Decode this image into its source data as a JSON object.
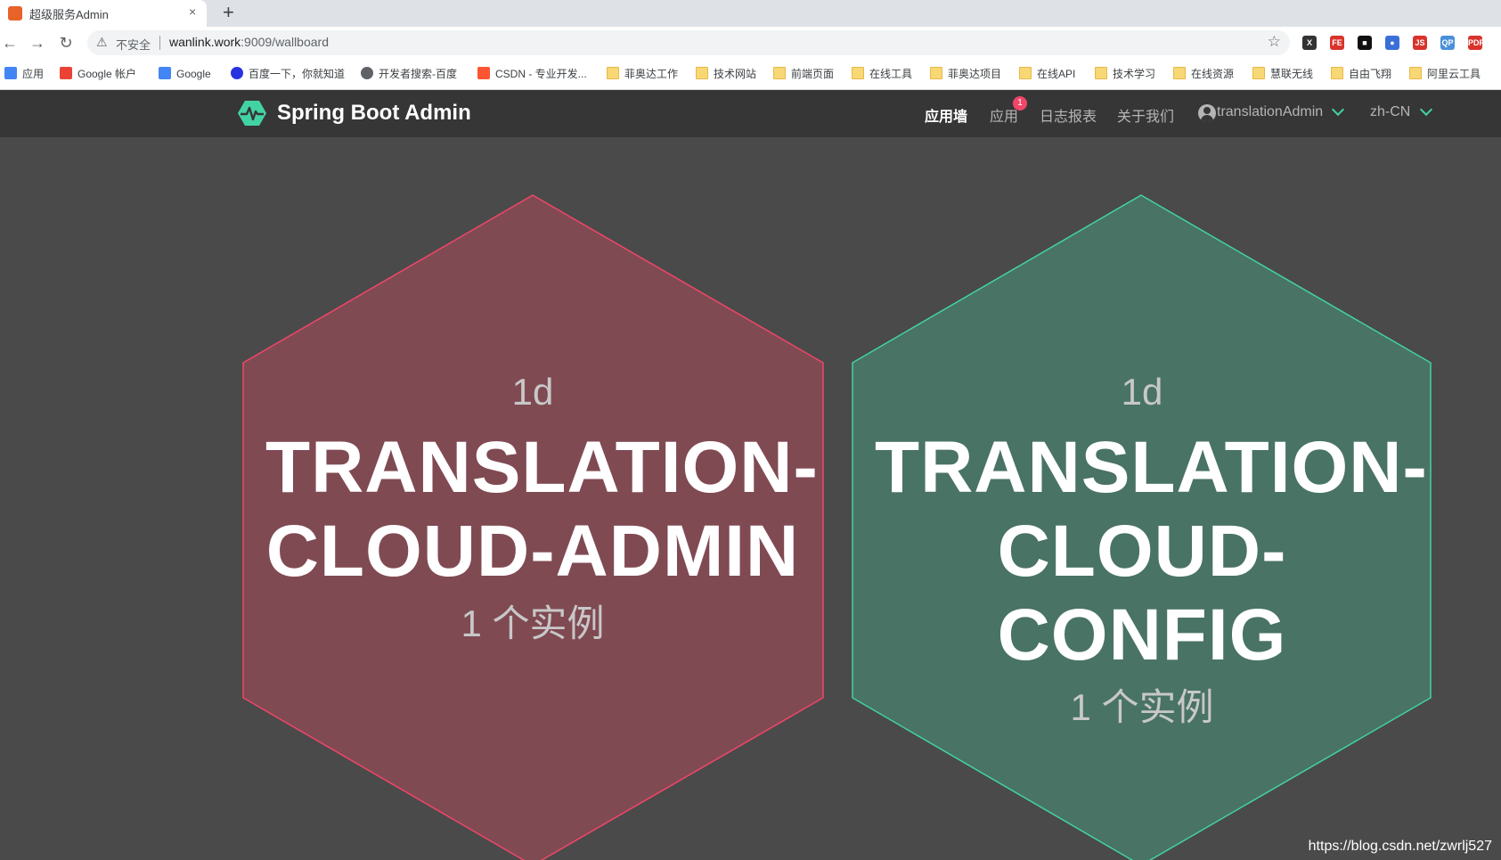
{
  "browser": {
    "tab_title": "超级服务Admin",
    "close_glyph": "×",
    "new_tab_glyph": "+",
    "insecure_label": "不安全",
    "url_host": "wanlink.work",
    "url_rest": ":9009/wallboard",
    "star_glyph": "☆",
    "nav": {
      "back": "←",
      "forward": "→",
      "reload": "↻"
    },
    "extensions": [
      {
        "name": "x-extension-icon",
        "label": "X",
        "color": "#333333"
      },
      {
        "name": "fe-extension-icon",
        "label": "FE",
        "color": "#d9332b"
      },
      {
        "name": "square-extension-icon",
        "label": "■",
        "color": "#111111"
      },
      {
        "name": "firefox-extension-icon",
        "label": "●",
        "color": "#3b6fd8"
      },
      {
        "name": "js-extension-icon",
        "label": "JS",
        "color": "#d9332b"
      },
      {
        "name": "qp-extension-icon",
        "label": "QP",
        "color": "#4a90d9"
      },
      {
        "name": "pdf-extension-icon",
        "label": "PDF",
        "color": "#d9332b"
      }
    ]
  },
  "bookmarks": [
    {
      "label": "应用",
      "icon": "apps-grid-icon"
    },
    {
      "label": "Google 帐户",
      "icon": "gmail-icon"
    },
    {
      "label": "Google",
      "icon": "google-icon"
    },
    {
      "label": "百度一下，你就知道",
      "icon": "baidu-icon"
    },
    {
      "label": "开发者搜索-百度",
      "icon": "globe-icon"
    },
    {
      "label": "CSDN - 专业开发...",
      "icon": "csdn-icon"
    },
    {
      "label": "菲奥达工作",
      "icon": "folder-icon"
    },
    {
      "label": "技术网站",
      "icon": "folder-icon"
    },
    {
      "label": "前端页面",
      "icon": "folder-icon"
    },
    {
      "label": "在线工具",
      "icon": "folder-icon"
    },
    {
      "label": "菲奥达项目",
      "icon": "folder-icon"
    },
    {
      "label": "在线API",
      "icon": "folder-icon"
    },
    {
      "label": "技术学习",
      "icon": "folder-icon"
    },
    {
      "label": "在线资源",
      "icon": "folder-icon"
    },
    {
      "label": "慧联无线",
      "icon": "folder-icon"
    },
    {
      "label": "自由飞翔",
      "icon": "folder-icon"
    },
    {
      "label": "阿里云工具",
      "icon": "folder-icon"
    }
  ],
  "app": {
    "brand": "Spring Boot Admin",
    "nav": {
      "wallboard": "应用墙",
      "applications": "应用",
      "applications_badge": "1",
      "journal": "日志报表",
      "about": "关于我们",
      "user": "translationAdmin",
      "language": "zh-CN"
    }
  },
  "wallboard": {
    "apps": [
      {
        "uptime": "1d",
        "name_line1": "TRANSLATION-",
        "name_line2": "CLOUD-ADMIN",
        "instances": "1 个实例",
        "status": "down",
        "fill": "#804a53",
        "stroke": "#f14668"
      },
      {
        "uptime": "1d",
        "name_line1": "TRANSLATION-",
        "name_line2": "CLOUD-CONFIG",
        "instances": "1 个实例",
        "status": "up",
        "fill": "#497365",
        "stroke": "#42d3a5"
      }
    ]
  },
  "watermark": "https://blog.csdn.net/zwrlj527"
}
